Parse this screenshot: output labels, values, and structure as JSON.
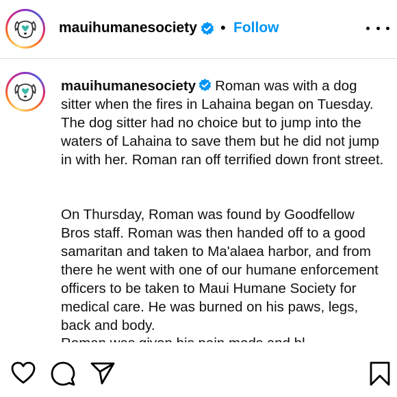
{
  "header": {
    "username": "mauihumanesociety",
    "separator": "•",
    "follow_label": "Follow"
  },
  "caption": {
    "username": "mauihumanesociety",
    "paragraph1": "Roman was with a dog sitter when the fires in Lahaina began on Tuesday. The dog sitter had no choice but to jump into the waters of Lahaina to save them but he did not jump in with her. Roman ran off terrified down front street.",
    "paragraph2": "On Thursday, Roman was found by Goodfellow Bros staff. Roman was then handed off to a good samaritan and taken to Ma'alaea harbor, and from there he went with one of our humane enforcement officers to be taken to Maui Humane Society for medical care. He was burned on his paws, legs, back and body.",
    "cut_line": "Roman was given his pain meds and bl..."
  },
  "icons": {
    "avatar": "dog-logo-icon",
    "verified": "verified-badge-icon",
    "more": "more-options-icon",
    "like": "heart-icon",
    "comment": "comment-icon",
    "share": "share-icon",
    "save": "bookmark-icon"
  },
  "colors": {
    "accent": "#0095f6",
    "verified": "#0095f6",
    "logo_teal": "#3bb8a8"
  }
}
